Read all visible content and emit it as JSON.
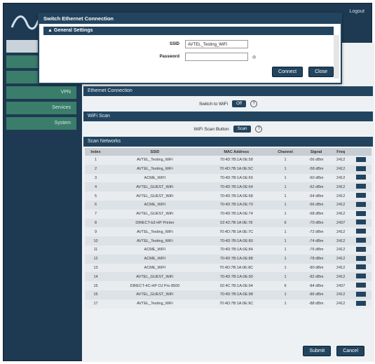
{
  "header": {
    "right_text": "Logout"
  },
  "sidebar": {
    "items": [
      {
        "label": "",
        "light": true
      },
      {
        "label": ""
      },
      {
        "label": ""
      },
      {
        "label": "VPN"
      },
      {
        "label": "Services"
      },
      {
        "label": "System"
      }
    ]
  },
  "modal": {
    "title": "Switch Ethernet Connection",
    "section": "General Settings",
    "ssid_label": "SSID",
    "ssid_value": "AVTEL_Testing_WiFi",
    "password_label": "Password",
    "password_value": "",
    "connect_label": "Connect",
    "close_label": "Close"
  },
  "content": {
    "ethernet_section": "Ethernet Connection",
    "ethernet_row_label": "Switch to WiFi",
    "ethernet_row_value": "Off",
    "wifi_scan_section": "WiFi Scan",
    "scan_row_label": "WiFi Scan Button",
    "scan_button": "Scan",
    "networks_section": "Scan Networks",
    "table_headers": [
      "Index",
      "SSID",
      "MAC Address",
      "Channel",
      "Signal",
      "Freq",
      ""
    ],
    "rows": [
      [
        "1",
        "AVTEL_Testing_WiFi",
        "70:4D:7B:1A:0E:58",
        "1",
        "-56 dBm",
        "2412"
      ],
      [
        "2",
        "AVTEL_Testing_WiFi",
        "70:4D:7B:1A:0E:5C",
        "1",
        "-58 dBm",
        "2412"
      ],
      [
        "3",
        "ACME_WIFI",
        "70:4D:7B:1A:0E:60",
        "1",
        "-60 dBm",
        "2412"
      ],
      [
        "4",
        "AVTEL_GUEST_WiFi",
        "70:4D:7B:1A:0E:64",
        "1",
        "-62 dBm",
        "2412"
      ],
      [
        "5",
        "AVTEL_GUEST_WiFi",
        "70:4D:7B:1A:0E:68",
        "1",
        "-64 dBm",
        "2412"
      ],
      [
        "6",
        "ACME_WIFI",
        "70:4D:7B:1A:0E:70",
        "1",
        "-66 dBm",
        "2412"
      ],
      [
        "7",
        "AVTEL_GUEST_WiFi",
        "70:4D:7B:1A:0E:74",
        "1",
        "-68 dBm",
        "2412"
      ],
      [
        "8",
        "DIRECT-b3-HP Printer",
        "02:42:7B:1A:0E:78",
        "6",
        "-70 dBm",
        "2437"
      ],
      [
        "9",
        "AVTEL_Testing_WiFi",
        "70:4D:7B:1A:0E:7C",
        "1",
        "-72 dBm",
        "2412"
      ],
      [
        "10",
        "AVTEL_Testing_WiFi",
        "70:4D:7B:1A:0E:80",
        "1",
        "-74 dBm",
        "2412"
      ],
      [
        "11",
        "ACME_WIFI",
        "70:4D:7B:1A:0E:84",
        "1",
        "-76 dBm",
        "2412"
      ],
      [
        "12",
        "ACME_WIFI",
        "70:4D:7B:1A:0E:88",
        "1",
        "-78 dBm",
        "2412"
      ],
      [
        "13",
        "ACME_WIFI",
        "70:4D:7B:1A:0E:8C",
        "1",
        "-80 dBm",
        "2412"
      ],
      [
        "14",
        "AVTEL_GUEST_WiFi",
        "70:4D:7B:1A:0E:90",
        "1",
        "-82 dBm",
        "2412"
      ],
      [
        "15",
        "DIRECT-4C-HP OJ Pro 8500",
        "02:4C:7B:1A:0E:94",
        "6",
        "-84 dBm",
        "2437"
      ],
      [
        "16",
        "AVTEL_GUEST_WiFi",
        "70:4D:7B:1A:0E:98",
        "1",
        "-86 dBm",
        "2412"
      ],
      [
        "17",
        "AVTEL_Testing_WiFi",
        "70:4D:7B:1A:0E:9C",
        "1",
        "-88 dBm",
        "2412"
      ]
    ],
    "submit_label": "Submit",
    "cancel_label": "Cancel"
  }
}
